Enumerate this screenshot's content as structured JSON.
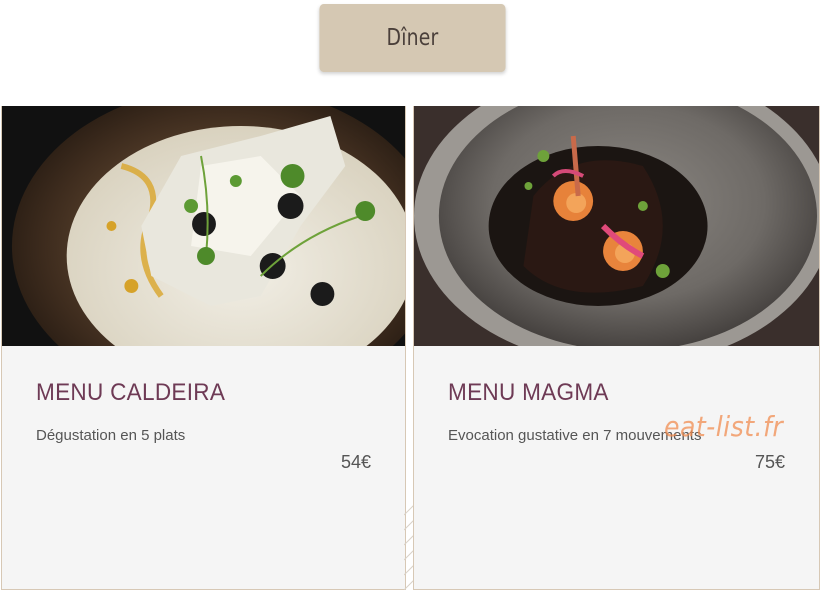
{
  "tab": {
    "label": "Dîner"
  },
  "menus": [
    {
      "title": "MENU CALDEIRA",
      "description": "Dégustation en 5 plats",
      "price": "54€"
    },
    {
      "title": "MENU MAGMA",
      "description": "Evocation gustative en 7 mouvements",
      "price": "75€"
    }
  ],
  "watermark": "eat-list.fr",
  "colors": {
    "tab_background": "#d5c8b3",
    "title": "#6e3a55",
    "card_background": "#f5f5f5",
    "watermark": "#f08c50"
  }
}
